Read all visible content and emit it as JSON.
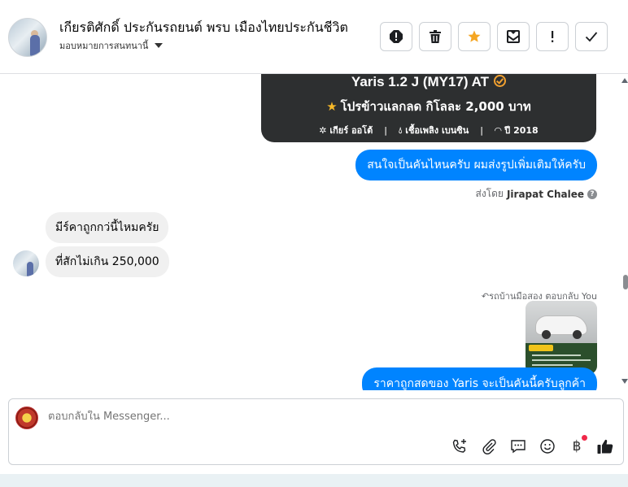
{
  "header": {
    "title": "เกียรติศักดิ์ ประกันรถยนต์ พรบ เมืองไทยประกันชีวิต",
    "assign_label": "มอบหมายการสนทนานี้",
    "buttons": [
      {
        "name": "alert-button",
        "icon": "exclamation-circle-icon"
      },
      {
        "name": "delete-button",
        "icon": "trash-icon"
      },
      {
        "name": "star-button",
        "icon": "star-icon",
        "color": "#f5a623"
      },
      {
        "name": "mark-unread-button",
        "icon": "envelope-icon"
      },
      {
        "name": "spam-button",
        "icon": "exclamation-icon"
      },
      {
        "name": "done-button",
        "icon": "check-icon"
      }
    ]
  },
  "card": {
    "title": "Yaris 1.2 J (MY17) AT",
    "promo": "โปรข้าวแลกลด กิโลละ 2,000 บาท",
    "specs": [
      "เกียร์ ออโต้",
      "เชื้อเพลิง เบนซิน",
      "ปี 2018"
    ]
  },
  "messages": {
    "out_1": "สนใจเป็นคันไหนครับ ผมส่งรูปเพิ่มเติมให้ครับ",
    "sent_by_prefix": "ส่งโดย",
    "sent_by_name": "Jirapat Chalee",
    "in_1": "มีร์คาถูกกว่นี้ไหมครัย",
    "in_2": "ที่สักไม่เกิน 250,000",
    "reply_label": "รถบ้านมือสอง ตอบกลับ You",
    "out_2": "ราคาถูกสดของ Yaris จะเป็นคันนี้ครับลูกค้า"
  },
  "composer": {
    "placeholder": "ตอบกลับใน Messenger...",
    "tools": [
      "call-add-icon",
      "paperclip-icon",
      "chat-bubble-icon",
      "emoji-icon",
      "baht-icon",
      "thumbs-up-icon"
    ],
    "baht_symbol": "฿"
  },
  "colors": {
    "accent": "#0084ff",
    "card_bg": "#2d2f30",
    "star": "#f5a623",
    "notification": "#f02849"
  }
}
